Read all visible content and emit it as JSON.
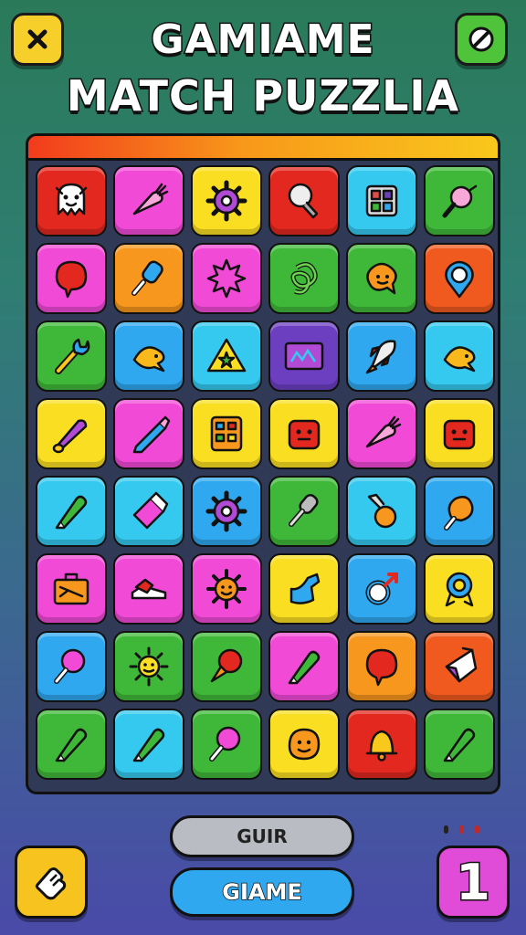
{
  "header": {
    "title_line1": "GAMIAME",
    "title_line2": "MATCH PUZZLIA",
    "close_icon": "close-icon",
    "settings_icon": "no-entry-icon"
  },
  "board": {
    "columns": 6,
    "rows": 8,
    "tiles": [
      {
        "bg": "#e2281f",
        "icon": "ghost"
      },
      {
        "bg": "#f04ad6",
        "icon": "carrot"
      },
      {
        "bg": "#f9de22",
        "icon": "gear"
      },
      {
        "bg": "#e2281f",
        "icon": "bulb"
      },
      {
        "bg": "#35c9ef",
        "icon": "panel"
      },
      {
        "bg": "#3fb839",
        "icon": "magnifier"
      },
      {
        "bg": "#f04ad6",
        "icon": "bubble"
      },
      {
        "bg": "#f7971e",
        "icon": "popsicle"
      },
      {
        "bg": "#f04ad6",
        "icon": "sun"
      },
      {
        "bg": "#3fb839",
        "icon": "knot"
      },
      {
        "bg": "#3fb839",
        "icon": "blob"
      },
      {
        "bg": "#f05a1e",
        "icon": "pin"
      },
      {
        "bg": "#3fb839",
        "icon": "wrench"
      },
      {
        "bg": "#2fa8ef",
        "icon": "fish"
      },
      {
        "bg": "#35c9ef",
        "icon": "triangle"
      },
      {
        "bg": "#6b3fc0",
        "icon": "screen"
      },
      {
        "bg": "#2fa8ef",
        "icon": "rocket"
      },
      {
        "bg": "#35c9ef",
        "icon": "fish"
      },
      {
        "bg": "#f9de22",
        "icon": "cone"
      },
      {
        "bg": "#f04ad6",
        "icon": "pencil"
      },
      {
        "bg": "#f9de22",
        "icon": "calculator"
      },
      {
        "bg": "#f9de22",
        "icon": "face-box"
      },
      {
        "bg": "#f04ad6",
        "icon": "carrot"
      },
      {
        "bg": "#f9de22",
        "icon": "face-box"
      },
      {
        "bg": "#35c9ef",
        "icon": "marker"
      },
      {
        "bg": "#35c9ef",
        "icon": "eraser"
      },
      {
        "bg": "#2fa8ef",
        "icon": "gear"
      },
      {
        "bg": "#3fb839",
        "icon": "microphone"
      },
      {
        "bg": "#35c9ef",
        "icon": "fruit"
      },
      {
        "bg": "#2fa8ef",
        "icon": "drumstick"
      },
      {
        "bg": "#f04ad6",
        "icon": "briefcase"
      },
      {
        "bg": "#f04ad6",
        "icon": "shoe"
      },
      {
        "bg": "#f04ad6",
        "icon": "flower"
      },
      {
        "bg": "#f9de22",
        "icon": "boot"
      },
      {
        "bg": "#2fa8ef",
        "icon": "male"
      },
      {
        "bg": "#f9de22",
        "icon": "badge"
      },
      {
        "bg": "#2fa8ef",
        "icon": "lollipop"
      },
      {
        "bg": "#3fb839",
        "icon": "sun-face"
      },
      {
        "bg": "#3fb839",
        "icon": "icecream"
      },
      {
        "bg": "#f04ad6",
        "icon": "marker"
      },
      {
        "bg": "#f7971e",
        "icon": "bubble"
      },
      {
        "bg": "#f05a1e",
        "icon": "kite"
      },
      {
        "bg": "#3fb839",
        "icon": "marker"
      },
      {
        "bg": "#35c9ef",
        "icon": "marker"
      },
      {
        "bg": "#3fb839",
        "icon": "lollipop"
      },
      {
        "bg": "#f9de22",
        "icon": "blob-face"
      },
      {
        "bg": "#e2281f",
        "icon": "bell"
      },
      {
        "bg": "#3fb839",
        "icon": "marker"
      }
    ]
  },
  "controls": {
    "quit_label": "GUIR",
    "game_label": "GIAME",
    "hint_icon": "hand-icon",
    "level_value": "1"
  }
}
